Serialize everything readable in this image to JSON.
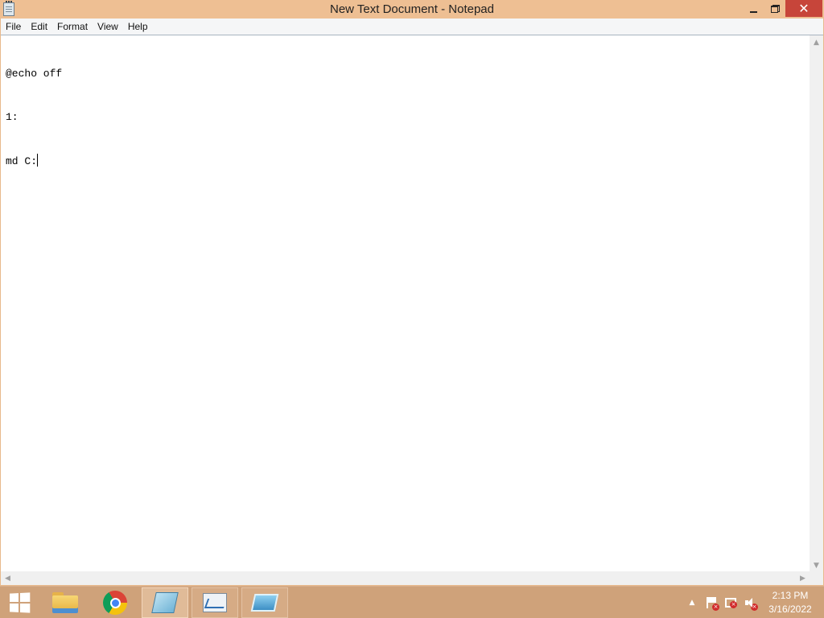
{
  "window": {
    "title": "New Text Document - Notepad",
    "close_glyph": "✕"
  },
  "menu": [
    "File",
    "Edit",
    "Format",
    "View",
    "Help"
  ],
  "document": {
    "lines": [
      "@echo off",
      "1:",
      "md C:"
    ]
  },
  "scrollbars": {
    "up": "▲",
    "down": "▼",
    "left": "◀",
    "right": "▶"
  },
  "taskbar": {
    "apps": [
      {
        "name": "File Explorer",
        "icon": "folder-icon"
      },
      {
        "name": "Google Chrome",
        "icon": "chrome-icon"
      },
      {
        "name": "Notepad",
        "icon": "notepad-icon",
        "active": true
      },
      {
        "name": "Performance Monitor",
        "icon": "perfmon-icon"
      },
      {
        "name": "Remote Desktop",
        "icon": "rdp-icon"
      }
    ],
    "tray": {
      "show_hidden": "▲",
      "badge": "×"
    },
    "clock": {
      "time": "2:13 PM",
      "date": "3/16/2022"
    }
  },
  "colors": {
    "accent": "#eebf93",
    "taskbar": "#cfa27a",
    "close_button": "#c7453a"
  }
}
